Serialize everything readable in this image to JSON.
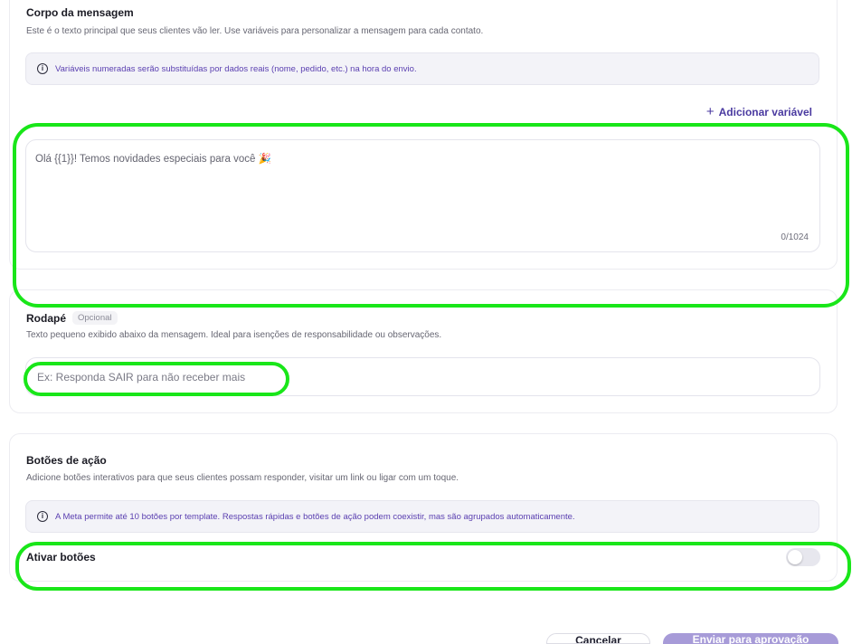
{
  "body_section": {
    "title": "Corpo da mensagem",
    "description": "Este é o texto principal que seus clientes vão ler. Use variáveis para personalizar a mensagem para cada contato.",
    "info_text": "Variáveis numeradas serão substituídas por dados reais (nome, pedido, etc.) na hora do envio.",
    "add_variable_label": "Adicionar variável",
    "textarea_value": "Olá {{1}}! Temos novidades especiais para você 🎉",
    "char_counter": "0/1024"
  },
  "footer_section": {
    "title": "Rodapé",
    "badge": "Opcional",
    "description": "Texto pequeno exibido abaixo da mensagem. Ideal para isenções de responsabilidade ou observações.",
    "input_placeholder": "Ex: Responda SAIR para não receber mais"
  },
  "buttons_section": {
    "title": "Botões de ação",
    "description": "Adicione botões interativos para que seus clientes possam responder, visitar um link ou ligar com um toque.",
    "info_text": "A Meta permite até 10 botões por template. Respostas rápidas e botões de ação podem coexistir, mas são agrupados automaticamente.",
    "toggle_label": "Ativar botões",
    "toggle_on": false
  },
  "actions": {
    "cancel_label": "Cancelar",
    "submit_label": "Enviar para aprovação"
  },
  "icons": {
    "info": "info-circle-icon",
    "plus": "plus-icon"
  },
  "colors": {
    "accent": "#4a3aa0",
    "submit_bg": "#a79bd8",
    "highlight": "#19e619"
  }
}
